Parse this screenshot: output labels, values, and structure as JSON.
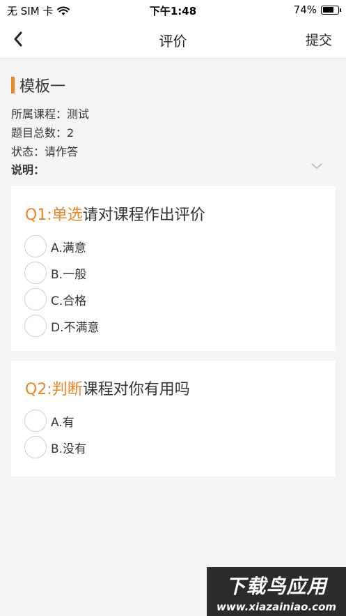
{
  "status_bar": {
    "carrier": "无 SIM 卡",
    "time": "下午1:48",
    "battery_percent": "74%",
    "battery_level": 0.74
  },
  "nav": {
    "title": "评价",
    "submit_label": "提交",
    "back_icon": "chevron-left-icon"
  },
  "template": {
    "title": "模板一",
    "course_label": "所属课程：",
    "course_value": "测试",
    "count_label": "题目总数：",
    "count_value": "2",
    "status_label": "状态：",
    "status_value": "请作答",
    "desc_label": "说明：",
    "expand_icon": "chevron-down-icon"
  },
  "questions": [
    {
      "prefix": "Q1:单选",
      "text": "请对课程作出评价",
      "options": [
        "A.满意",
        "B.一般",
        "C.合格",
        "D.不满意"
      ]
    },
    {
      "prefix": "Q2:判断",
      "text": "课程对你有用吗",
      "options": [
        "A.有",
        "B.没有"
      ]
    }
  ],
  "watermark": {
    "line1": "下载鸟应用",
    "line2": "www.xiazainiao.com"
  },
  "colors": {
    "accent": "#f08324",
    "background": "#f4f4f4",
    "card": "#ffffff"
  }
}
